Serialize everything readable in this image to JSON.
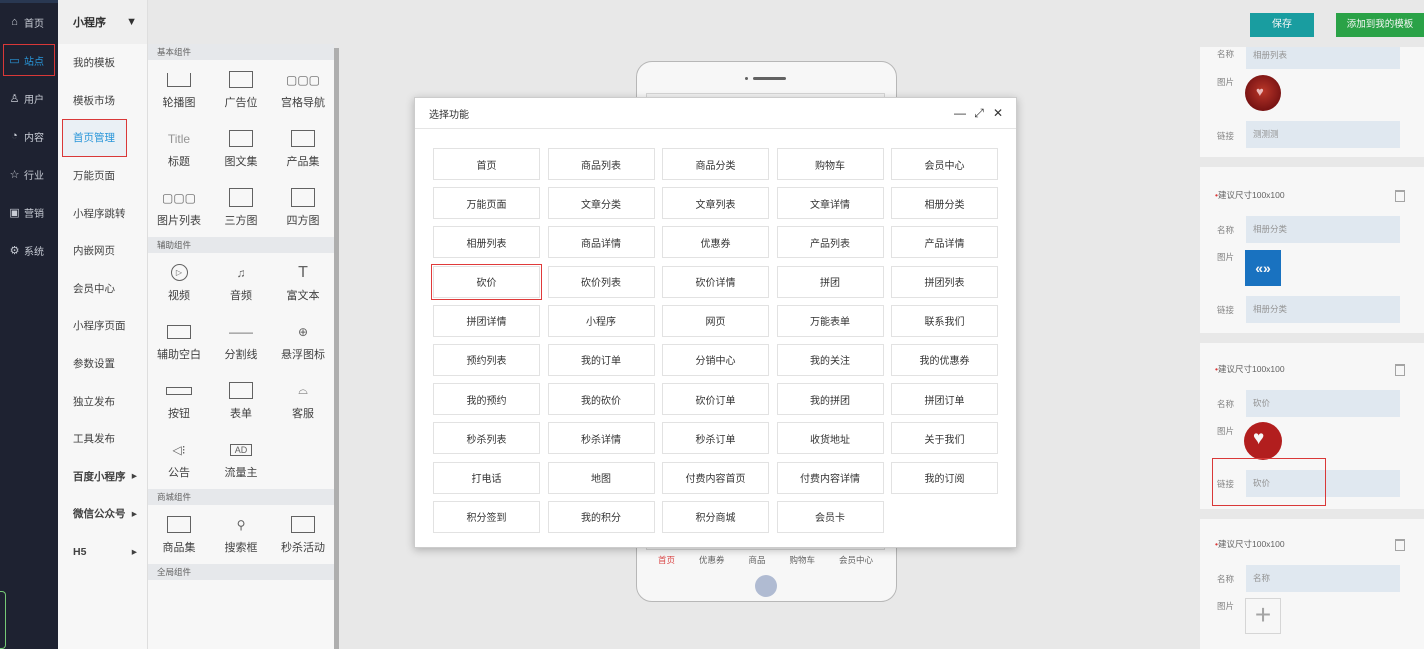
{
  "nav": {
    "items": [
      {
        "icon": "home-icon",
        "glyph": "⌂",
        "label": "首页"
      },
      {
        "icon": "monitor-icon",
        "glyph": "▭",
        "label": "站点"
      },
      {
        "icon": "user-icon",
        "glyph": "♙",
        "label": "用户"
      },
      {
        "icon": "chat-icon",
        "glyph": "◔",
        "label": "内容"
      },
      {
        "icon": "star-icon",
        "glyph": "☆",
        "label": "行业"
      },
      {
        "icon": "calendar-icon",
        "glyph": "▣",
        "label": "营销"
      },
      {
        "icon": "gear-icon",
        "glyph": "⚙",
        "label": "系统"
      }
    ]
  },
  "menu": {
    "header": "小程序",
    "items": [
      {
        "label": "我的模板",
        "arrow": ""
      },
      {
        "label": "模板市场",
        "arrow": ""
      },
      {
        "label": "首页管理",
        "arrow": ""
      },
      {
        "label": "万能页面",
        "arrow": ""
      },
      {
        "label": "小程序跳转",
        "arrow": ""
      },
      {
        "label": "内嵌网页",
        "arrow": ""
      },
      {
        "label": "会员中心",
        "arrow": ""
      },
      {
        "label": "小程序页面",
        "arrow": ""
      },
      {
        "label": "参数设置",
        "arrow": ""
      },
      {
        "label": "独立发布",
        "arrow": ""
      },
      {
        "label": "工具发布",
        "arrow": ""
      },
      {
        "label": "百度小程序",
        "arrow": "▸"
      },
      {
        "label": "微信公众号",
        "arrow": "▸"
      },
      {
        "label": "H5",
        "arrow": "▸"
      }
    ]
  },
  "components": {
    "basic_header": "基本组件",
    "basic": [
      "轮播图",
      "广告位",
      "宫格导航",
      "标题",
      "图文集",
      "产品集",
      "图片列表",
      "三方图",
      "四方图"
    ],
    "title_icon_text": "Title",
    "aux_header": "辅助组件",
    "aux": [
      "视频",
      "音频",
      "富文本",
      "辅助空白",
      "分割线",
      "悬浮图标",
      "按钮",
      "表单",
      "客服",
      "公告",
      "流量主"
    ],
    "ad_icon_text": "AD",
    "mall_header": "商城组件",
    "mall": [
      "商品集",
      "搜索框",
      "秒杀活动"
    ],
    "global_header": "全局组件"
  },
  "toolbar": {
    "save": "保存",
    "add_template": "添加到我的模板"
  },
  "phone": {
    "tabs": [
      "首页",
      "优惠券",
      "商品",
      "购物车",
      "会员中心"
    ]
  },
  "right_panel": {
    "name_label": "名称",
    "image_label": "图片",
    "link_label": "链接",
    "size_hint": "建议尺寸100x100",
    "card0": {
      "name_value": "相册列表",
      "link_value": "测测测"
    },
    "card1": {
      "name_value": "相册分类",
      "link_value": "相册分类"
    },
    "card2": {
      "name_value": "砍价",
      "link_value": "砍价"
    },
    "card3": {
      "name_value": "名称"
    }
  },
  "modal": {
    "title": "选择功能",
    "minimize": "—",
    "maximize": "⤢",
    "close": "✕",
    "functions": [
      "首页",
      "商品列表",
      "商品分类",
      "购物车",
      "会员中心",
      "万能页面",
      "文章分类",
      "文章列表",
      "文章详情",
      "相册分类",
      "相册列表",
      "商品详情",
      "优惠券",
      "产品列表",
      "产品详情",
      "砍价",
      "砍价列表",
      "砍价详情",
      "拼团",
      "拼团列表",
      "拼团详情",
      "小程序",
      "网页",
      "万能表单",
      "联系我们",
      "预约列表",
      "我的订单",
      "分销中心",
      "我的关注",
      "我的优惠券",
      "我的预约",
      "我的砍价",
      "砍价订单",
      "我的拼团",
      "拼团订单",
      "秒杀列表",
      "秒杀详情",
      "秒杀订单",
      "收货地址",
      "关于我们",
      "打电话",
      "地图",
      "付费内容首页",
      "付费内容详情",
      "我的订阅",
      "积分签到",
      "我的积分",
      "积分商城",
      "会员卡"
    ]
  },
  "colors": {
    "nav_bg": "#1f2433",
    "accent_blue": "#2b9be0",
    "save_teal": "#1aa3a6",
    "add_green": "#2ca84a",
    "highlight_red": "#e03a3a"
  }
}
